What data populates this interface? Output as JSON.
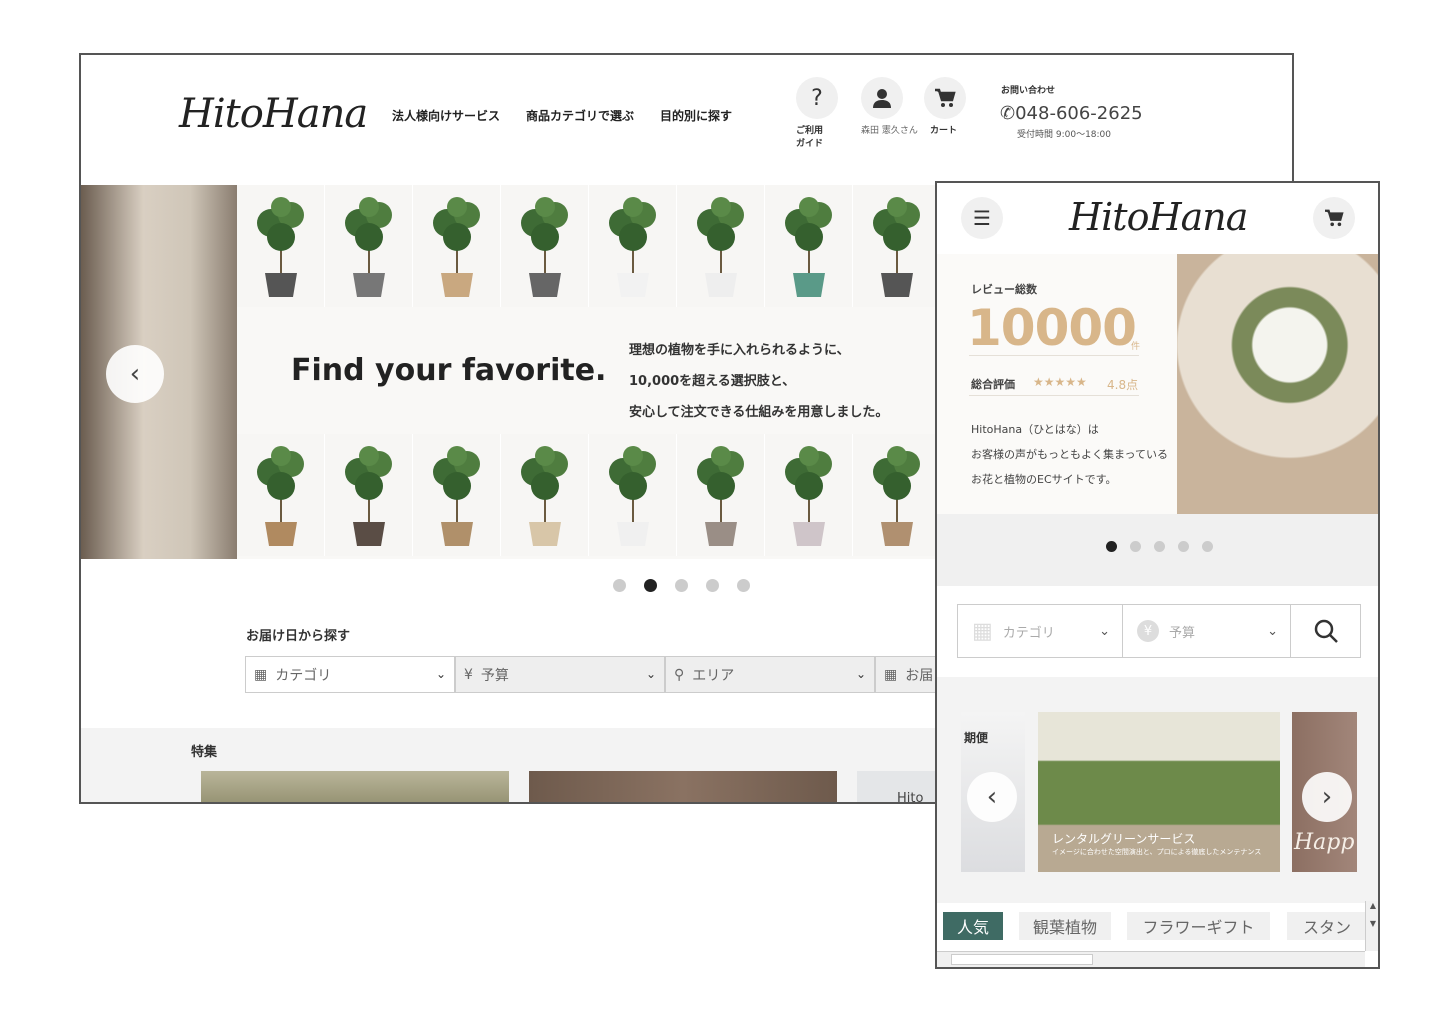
{
  "desktop": {
    "logo": "HitoHana",
    "nav": [
      "法人様向けサービス",
      "商品カテゴリで選ぶ",
      "目的別に探す"
    ],
    "icons": [
      {
        "icon": "help-icon",
        "label": "ご利用ガイド"
      },
      {
        "icon": "user-icon",
        "label": "森田 憲久さん"
      },
      {
        "icon": "cart-icon",
        "label": "カート"
      }
    ],
    "contact": {
      "title": "お問い合わせ",
      "phone": "048-606-2625",
      "hours": "受付時間 9:00〜18:00"
    },
    "hero": {
      "headline": "Find your favorite.",
      "lines": [
        "理想の植物を手に入れられるように、",
        "10,000を超える選択肢と、",
        "安心して注文できる仕組みを用意しました。"
      ],
      "active_slide": 2,
      "slides": 5
    },
    "search": {
      "title": "お届け日から探す",
      "fields": [
        "カテゴリ",
        "予算",
        "エリア",
        "お届"
      ]
    },
    "feature": {
      "title": "特集",
      "card3_text": "Hito"
    }
  },
  "mobile": {
    "logo": "HitoHana",
    "hero": {
      "review_label": "レビュー総数",
      "review_count": "10000",
      "unit": "件",
      "rating_label": "総合評価",
      "stars": "★★★★★",
      "rating": "4.8点",
      "desc": [
        "HitoHana（ひとはな）は",
        "お客様の声がもっともよく集まっている",
        "お花と植物のECサイトです。"
      ],
      "active_slide": 1,
      "slides": 5
    },
    "search": {
      "fields": [
        "カテゴリ",
        "予算"
      ]
    },
    "feature": {
      "side_text": "期便",
      "card_title": "レンタルグリーンサービス",
      "card_sub": "イメージに合わせた空間演出と、プロによる徹底したメンテナンス",
      "card3_text": "Happ"
    },
    "tabs": [
      "人気",
      "観葉植物",
      "フラワーギフト",
      "スタン"
    ],
    "accent": "#3f6b64"
  }
}
